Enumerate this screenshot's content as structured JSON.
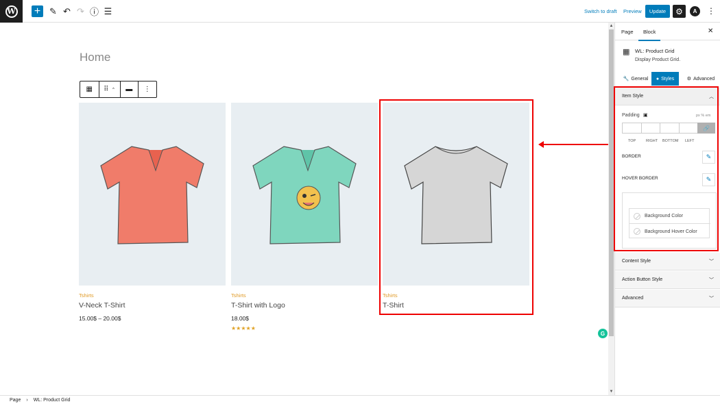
{
  "topbar": {
    "switch_to_draft": "Switch to draft",
    "preview": "Preview",
    "update": "Update"
  },
  "page_title": "Home",
  "products": [
    {
      "category": "Tshirts",
      "name": "V-Neck T-Shirt",
      "price": "15.00$ – 20.00$",
      "stars": "",
      "color": "#f07c6a"
    },
    {
      "category": "Tshirts",
      "name": "T-Shirt with Logo",
      "price": "18.00$",
      "stars": "★★★★★",
      "color": "#7fd6be"
    },
    {
      "category": "Tshirts",
      "name": "T-Shirt",
      "price": "",
      "stars": "",
      "color": "#d6d6d6"
    }
  ],
  "sidebar": {
    "tabs": {
      "page": "Page",
      "block": "Block"
    },
    "block_name": "WL: Product Grid",
    "block_desc": "Display Product Grid.",
    "style_tabs": {
      "general": "General",
      "styles": "Styles",
      "advanced": "Advanced"
    },
    "item_style": {
      "title": "Item Style",
      "padding_label": "Padding",
      "unit_label": "px % em",
      "sides": [
        "TOP",
        "RIGHT",
        "BOTTOM",
        "LEFT"
      ],
      "border_label": "BORDER",
      "hover_border_label": "HOVER BORDER",
      "background_color": "Background Color",
      "background_hover_color": "Background Hover Color"
    },
    "sections": [
      "Content Style",
      "Action Button Style",
      "Advanced"
    ]
  },
  "footer": {
    "page": "Page",
    "block": "WL: Product Grid"
  },
  "colors": {
    "accent": "#007cba",
    "highlight": "#e00000",
    "category": "#e09b28"
  }
}
